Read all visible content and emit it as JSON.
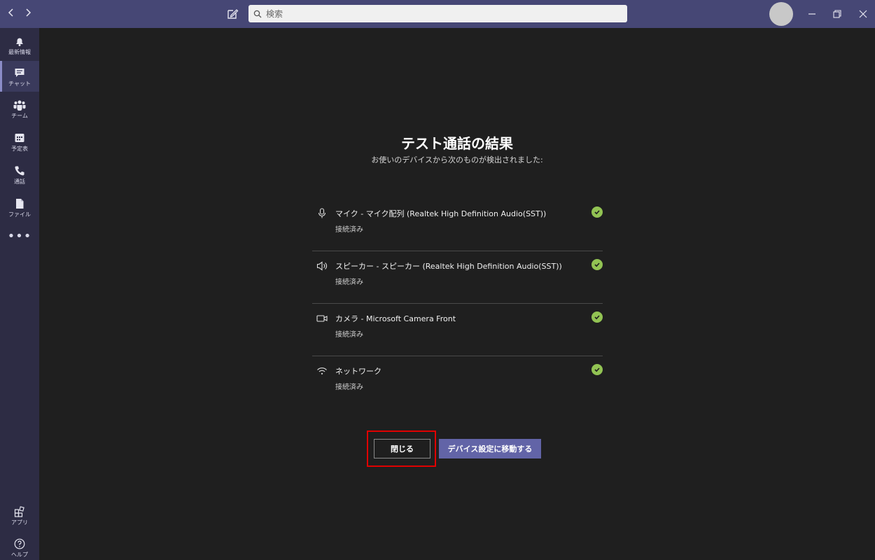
{
  "titlebar": {
    "back_icon": "chevron-left-icon",
    "forward_icon": "chevron-right-icon",
    "compose_icon": "compose-icon",
    "search_placeholder": "検索"
  },
  "rail": {
    "items": [
      {
        "label": "最新情報",
        "icon": "bell-icon"
      },
      {
        "label": "チャット",
        "icon": "chat-icon"
      },
      {
        "label": "チーム",
        "icon": "teams-icon"
      },
      {
        "label": "予定表",
        "icon": "calendar-icon"
      },
      {
        "label": "通話",
        "icon": "phone-icon"
      },
      {
        "label": "ファイル",
        "icon": "file-icon"
      }
    ],
    "more": "•••",
    "apps_label": "アプリ",
    "help_label": "ヘルプ"
  },
  "main": {
    "title": "テスト通話の結果",
    "subtitle": "お使いのデバイスから次のものが検出されました:",
    "devices": [
      {
        "name": "マイク - マイク配列 (Realtek High Definition Audio(SST))",
        "status": "接続済み",
        "icon": "microphone-icon"
      },
      {
        "name": "スピーカー - スピーカー (Realtek High Definition Audio(SST))",
        "status": "接続済み",
        "icon": "speaker-icon"
      },
      {
        "name": "カメラ - Microsoft Camera Front",
        "status": "接続済み",
        "icon": "camera-icon"
      },
      {
        "name": "ネットワーク",
        "status": "接続済み",
        "icon": "wifi-icon"
      }
    ],
    "close_label": "閉じる",
    "settings_label": "デバイス設定に移動する"
  },
  "colors": {
    "titlebar": "#464775",
    "rail": "#2d2c44",
    "background": "#1f1f1f",
    "accent": "#6264a7",
    "success": "#92c353",
    "highlight": "#e00000"
  }
}
